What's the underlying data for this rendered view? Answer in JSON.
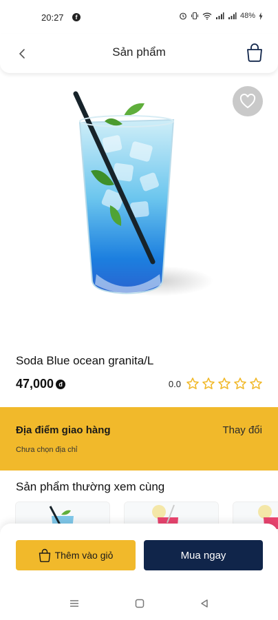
{
  "status_bar": {
    "time": "20:27",
    "battery": "48%",
    "icons": [
      "facebook-icon",
      "alarm-icon",
      "vibrate-icon",
      "wifi-icon",
      "signal-icon",
      "signal-icon",
      "battery-charging-icon"
    ]
  },
  "header": {
    "title": "Sản phẩm",
    "back_icon": "chevron-left-icon",
    "cart_icon": "shopping-bag-icon"
  },
  "product": {
    "name": "Soda Blue ocean granita/L",
    "price": "47,000",
    "currency_symbol": "đ",
    "rating": "0.0",
    "stars_filled": 0,
    "stars_total": 5,
    "image": "blue-soda-glass"
  },
  "delivery": {
    "title": "Địa điểm giao hàng",
    "change_label": "Thay đổi",
    "address": "Chưa chọn địa chỉ"
  },
  "related": {
    "title": "Sản phẩm thường xem cùng"
  },
  "actions": {
    "add_to_cart": "Thêm vào giỏ",
    "buy_now": "Mua ngay"
  },
  "colors": {
    "accent_yellow": "#f1b92b",
    "navy": "#10254a",
    "star": "#f1b92b"
  }
}
